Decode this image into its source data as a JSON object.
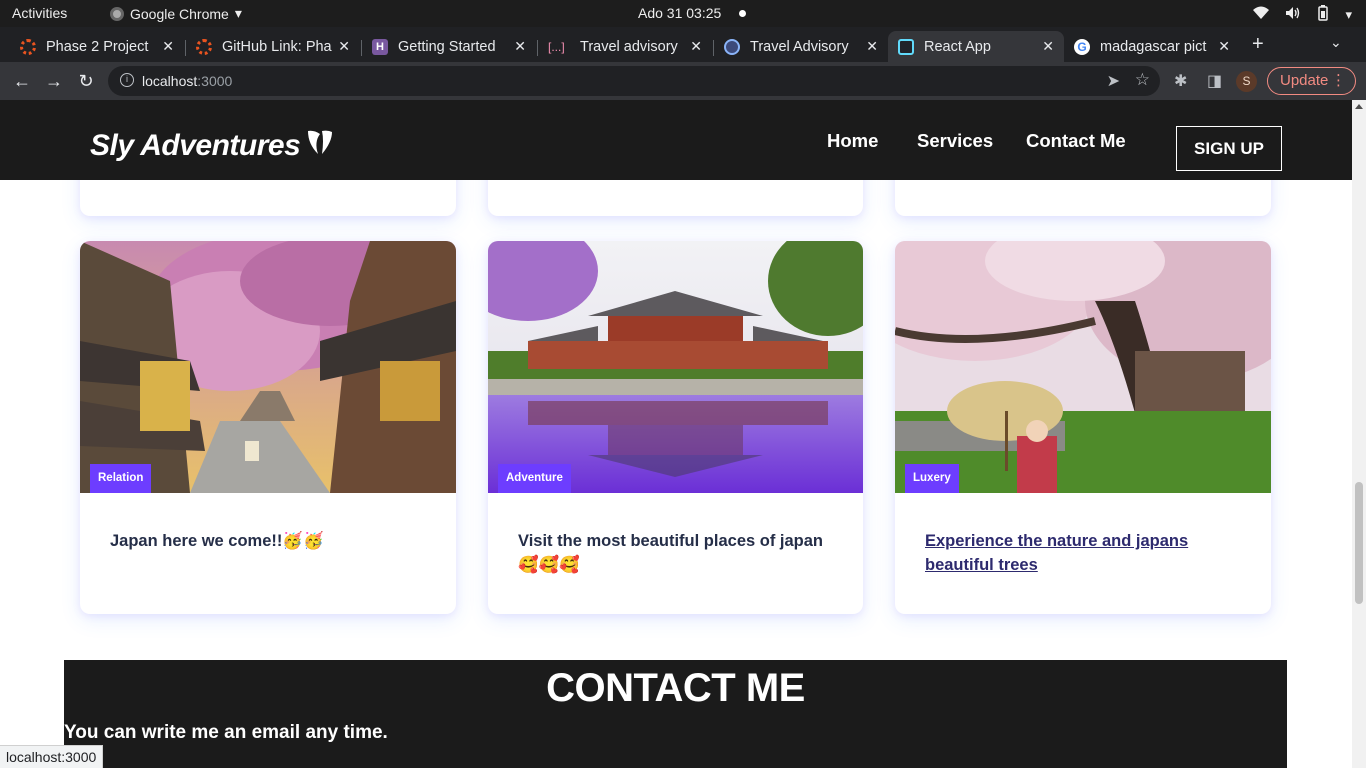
{
  "system_bar": {
    "activities": "Activities",
    "app_name": "Google Chrome",
    "clock": "Ado 31  03:25"
  },
  "tabs": [
    {
      "title": "Phase 2 Project",
      "favicon": "ubuntu-icon",
      "color": "#e95420",
      "active": false
    },
    {
      "title": "GitHub Link: Pha",
      "favicon": "ubuntu-icon",
      "color": "#e95420",
      "active": false
    },
    {
      "title": "Getting Started",
      "favicon": "heroku-icon",
      "color": "#79589f",
      "active": false
    },
    {
      "title": "Travel advisory",
      "favicon": "bracket-icon",
      "color": "#f48fb1",
      "active": false
    },
    {
      "title": "Travel Advisory",
      "favicon": "globe-icon",
      "color": "#8ab4f8",
      "active": false
    },
    {
      "title": "React App",
      "favicon": "react-icon",
      "color": "#61dafb",
      "active": true
    },
    {
      "title": "madagascar pict",
      "favicon": "google-icon",
      "color": "#4285f4",
      "active": false
    }
  ],
  "address_bar": {
    "host": "localhost",
    "port": ":3000"
  },
  "update_label": "Update",
  "profile_initial": "S",
  "site": {
    "brand": "Sly Adventures",
    "nav": [
      "Home",
      "Services",
      "Contact Me"
    ],
    "signup": "SIGN UP",
    "accent_color": "#6d3dff"
  },
  "cards": [
    {
      "tag": "Relation",
      "caption": "Japan here we come!!🥳🥳",
      "link": false
    },
    {
      "tag": "Adventure",
      "caption": "Visit the most beautiful places of japan 🥰🥰🥰",
      "link": false
    },
    {
      "tag": "Luxery",
      "caption": "Experience the nature and japans beautiful trees",
      "link": true
    }
  ],
  "contact": {
    "heading": "CONTACT ME",
    "text": "You can write me an email any time."
  },
  "status_url": "localhost:3000"
}
